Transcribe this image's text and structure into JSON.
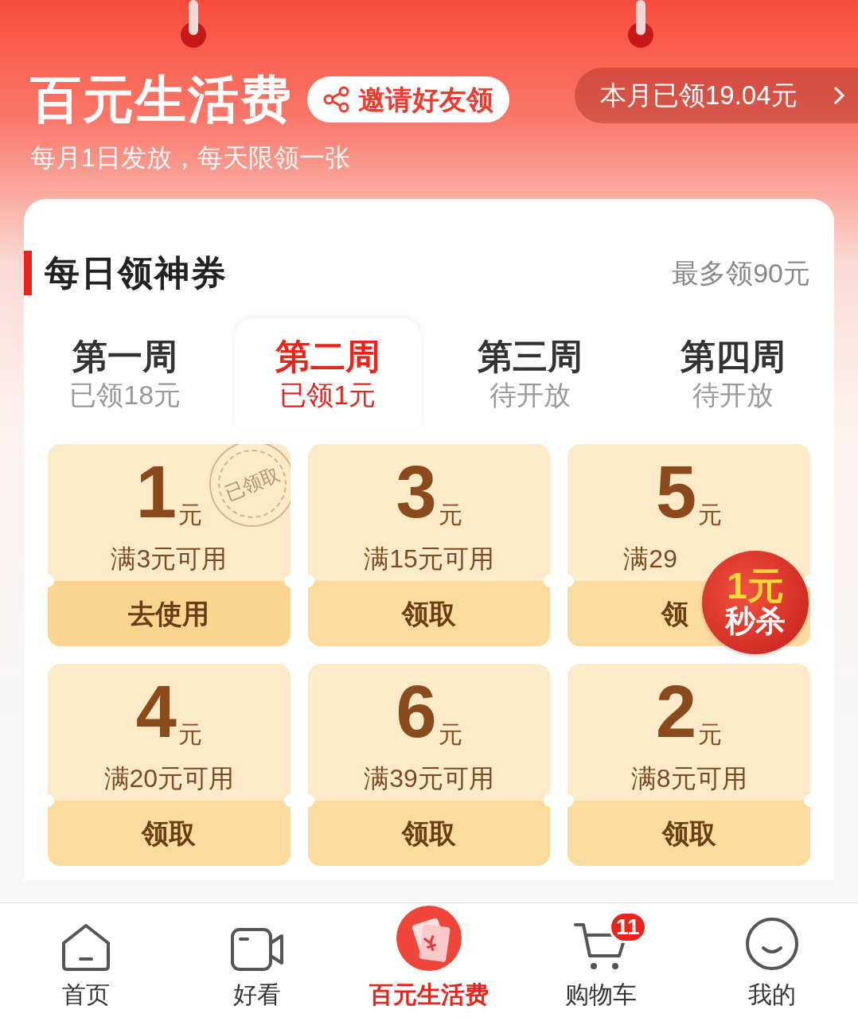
{
  "header": {
    "title": "百元生活费",
    "invite_button": "邀请好友领",
    "monthly_claimed": "本月已领19.04元",
    "subtitle": "每月1日发放，每天限领一张"
  },
  "section": {
    "title": "每日领神券",
    "max_note": "最多领90元"
  },
  "tabs": [
    {
      "label": "第一周",
      "status": "已领18元",
      "selected": false
    },
    {
      "label": "第二周",
      "status": "已领1元",
      "selected": true
    },
    {
      "label": "第三周",
      "status": "待开放",
      "selected": false
    },
    {
      "label": "第四周",
      "status": "待开放",
      "selected": false
    }
  ],
  "coupons": [
    {
      "amount": "1",
      "unit": "元",
      "condition": "满3元可用",
      "action": "去使用",
      "claimed": true,
      "stamp": "已领取"
    },
    {
      "amount": "3",
      "unit": "元",
      "condition": "满15元可用",
      "action": "领取",
      "claimed": false
    },
    {
      "amount": "5",
      "unit": "元",
      "condition": "满29",
      "action": "领",
      "claimed": false,
      "promo": {
        "top": "1元",
        "bottom": "秒杀"
      }
    },
    {
      "amount": "4",
      "unit": "元",
      "condition": "满20元可用",
      "action": "领取",
      "claimed": false
    },
    {
      "amount": "6",
      "unit": "元",
      "condition": "满39元可用",
      "action": "领取",
      "claimed": false
    },
    {
      "amount": "2",
      "unit": "元",
      "condition": "满8元可用",
      "action": "领取",
      "claimed": false
    }
  ],
  "nav": [
    {
      "label": "首页",
      "kind": "home",
      "selected": false
    },
    {
      "label": "好看",
      "kind": "video",
      "selected": false
    },
    {
      "label": "百元生活费",
      "kind": "envelope",
      "selected": true
    },
    {
      "label": "购物车",
      "kind": "cart",
      "selected": false,
      "badge": "11"
    },
    {
      "label": "我的",
      "kind": "profile",
      "selected": false
    }
  ]
}
